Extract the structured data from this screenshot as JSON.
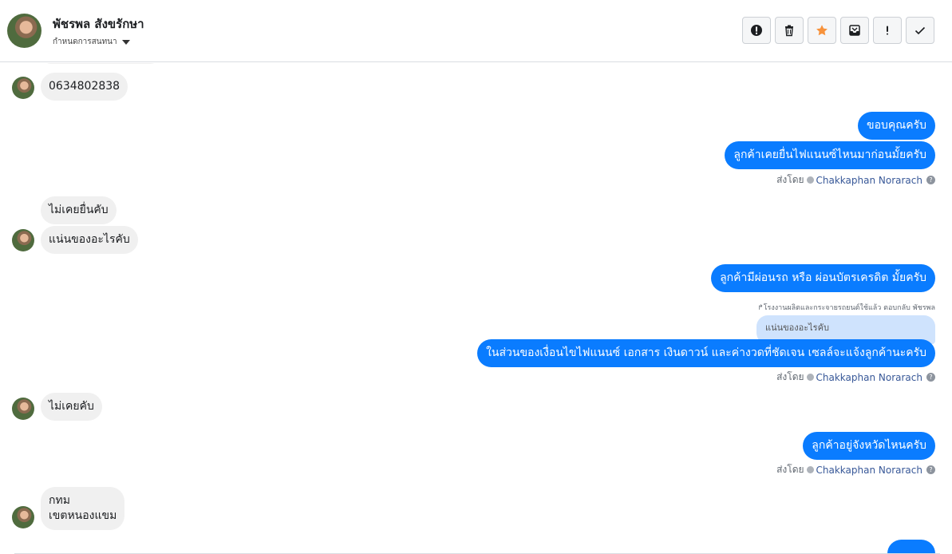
{
  "header": {
    "name": "พัชรพล สังขรักษา",
    "settings_label": "กำหนดการสนทนา",
    "actions": [
      {
        "icon": "alert-icon",
        "color": "#1c1e21"
      },
      {
        "icon": "trash-icon",
        "color": "#1c1e21"
      },
      {
        "icon": "star-icon",
        "color": "#f7923b"
      },
      {
        "icon": "inbox-icon",
        "color": "#1c1e21"
      },
      {
        "icon": "exclamation-icon",
        "color": "#1c1e21"
      },
      {
        "icon": "check-icon",
        "color": "#1c1e21"
      }
    ]
  },
  "messages": {
    "in_phone": "0634802838",
    "out_thanks": "ขอบคุณครับ",
    "out_q1": "ลูกค้าเคยยื่นไฟแนนซ์ไหนมาก่อนมั้ยครับ",
    "in_never1": "ไม่เคยยื่นคับ",
    "in_what": "แน่นของอะไรคับ",
    "out_q2": "ลูกค้ามีผ่อนรถ หรือ ผ่อนบัตรเครดิต มั้ยครับ",
    "reply_note": "โรงงานผลิตและกระจายรถยนต์ใช้แล้ว ตอบกลับ พัชรพล",
    "quoted": "แน่นของอะไรคับ",
    "out_explain": "ในส่วนของเงื่อนไขไฟแนนซ์ เอกสาร เงินดาวน์ และค่างวดที่ชัดเจน เซลล์จะแจ้งลูกค้านะครับ",
    "in_never2": "ไม่เคยคับ",
    "out_q3": "ลูกค้าอยู่จังหวัดไหนครับ",
    "in_loc1": "กทม",
    "in_loc2": "เขตหนองแขม"
  },
  "sent_by": {
    "prefix": "ส่งโดย",
    "agent": "Chakkaphan Norarach",
    "help": "?"
  },
  "colors": {
    "outgoing": "#0a7cff",
    "incoming": "#f0f0f0",
    "link": "#385898"
  }
}
